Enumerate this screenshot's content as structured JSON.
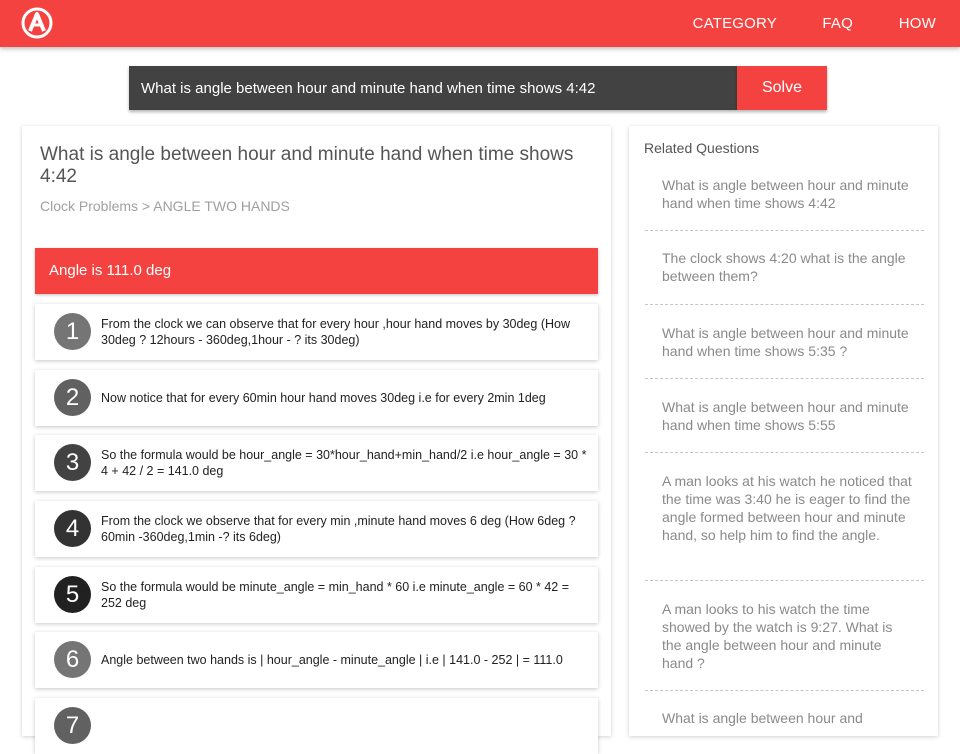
{
  "header": {
    "nav": [
      "CATEGORY",
      "FAQ",
      "HOW"
    ],
    "brand_color": "#f44240"
  },
  "search": {
    "value": "What is angle between hour and minute hand when time shows 4:42",
    "solve_label": "Solve"
  },
  "question": {
    "title": "What is angle between hour and minute hand when time shows 4:42",
    "breadcrumb": {
      "category": "Clock Problems",
      "separator": ">",
      "subcategory": "ANGLE TWO HANDS"
    },
    "answer": "Angle is 111.0 deg"
  },
  "steps": [
    {
      "num": "1",
      "text": "From the clock we can observe that for every hour ,hour hand moves by 30deg (How 30deg ? 12hours - 360deg,1hour - ? its 30deg)",
      "color": "#757575"
    },
    {
      "num": "2",
      "text": "Now notice that for every 60min hour hand moves 30deg i.e for every 2min 1deg",
      "color": "#616161"
    },
    {
      "num": "3",
      "text": "So the formula would be hour_angle = 30*hour_hand+min_hand/2 i.e hour_angle = 30 * 4 + 42 / 2 = 141.0 deg",
      "color": "#424242"
    },
    {
      "num": "4",
      "text": "From the clock we observe that for every min ,minute hand moves 6 deg (How 6deg ? 60min -360deg,1min -? its 6deg)",
      "color": "#333333"
    },
    {
      "num": "5",
      "text": "So the formula would be minute_angle = min_hand * 60 i.e minute_angle = 60 * 42 = 252 deg",
      "color": "#212121"
    },
    {
      "num": "6",
      "text": "Angle between two hands is | hour_angle - minute_angle | i.e | 141.0 - 252 | = 111.0",
      "color": "#757575"
    },
    {
      "num": "7",
      "text": "",
      "color": "#616161"
    }
  ],
  "related": {
    "title": "Related Questions",
    "items": [
      "What is angle between hour and minute hand when time shows 4:42",
      "The clock shows 4:20 what is the angle between them?",
      "What is angle between hour and minute hand when time shows 5:35 ?",
      "What is angle between hour and minute hand when time shows 5:55",
      "A man looks at his watch he noticed that the time was 3:40 he is eager to find the angle formed between hour and minute hand, so help him to find the angle.",
      "A man looks to his watch the time showed by the watch is 9:27. What is the angle between hour and minute hand ?",
      "What is angle between hour and"
    ]
  }
}
